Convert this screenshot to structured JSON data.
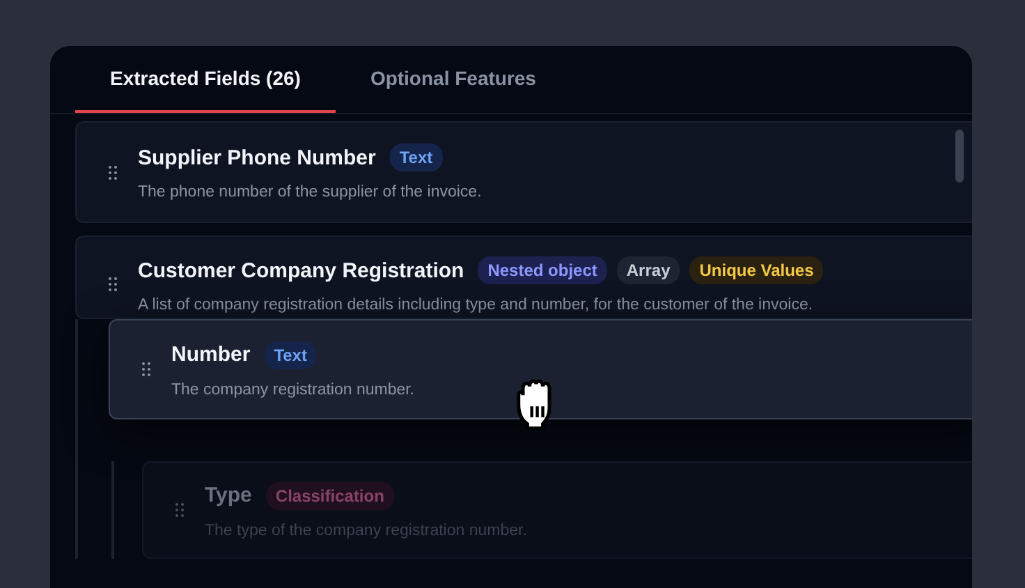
{
  "tabs": [
    {
      "label": "Extracted Fields (26)",
      "selected": true
    },
    {
      "label": "Optional Features",
      "selected": false
    }
  ],
  "fields": [
    {
      "name": "Supplier Phone Number",
      "description": "The phone number of the supplier of the invoice.",
      "tags": [
        {
          "label": "Text",
          "kind": "text"
        }
      ]
    },
    {
      "name": "Customer Company Registration",
      "description": "A list of company registration details including type and number, for the customer of the invoice.",
      "tags": [
        {
          "label": "Nested object",
          "kind": "nested"
        },
        {
          "label": "Array",
          "kind": "array"
        },
        {
          "label": "Unique Values",
          "kind": "unique"
        }
      ],
      "children": [
        {
          "name": "Number",
          "description": "The company registration number.",
          "dragging": true,
          "dimmed": false,
          "tags": [
            {
              "label": "Text",
              "kind": "text"
            }
          ]
        },
        {
          "name": "Type",
          "description": "The type of the company registration number.",
          "dragging": false,
          "dimmed": true,
          "tags": [
            {
              "label": "Classification",
              "kind": "classification"
            }
          ]
        }
      ]
    }
  ]
}
